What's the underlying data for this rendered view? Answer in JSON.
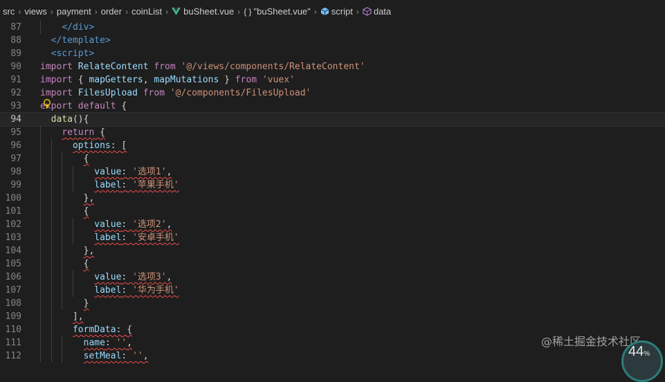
{
  "breadcrumb": {
    "items": [
      "src",
      "views",
      "payment",
      "order",
      "coinList",
      "buSheet.vue",
      "\"buSheet.vue\"",
      "script",
      "data"
    ],
    "icons": {
      "file": "vue-icon",
      "component": "braces-icon",
      "script": "cube-icon",
      "data": "cube-icon"
    }
  },
  "editor": {
    "current_line": "94",
    "lines": [
      {
        "n": "87",
        "text": "    </div>"
      },
      {
        "n": "88",
        "text": "  </template>"
      },
      {
        "n": "89",
        "text": "  <script>"
      },
      {
        "n": "90",
        "text": "import RelateContent from '@/views/components/RelateContent'"
      },
      {
        "n": "91",
        "text": "import { mapGetters, mapMutations } from 'vuex'"
      },
      {
        "n": "92",
        "text": "import FilesUpload from '@/components/FilesUpload'"
      },
      {
        "n": "93",
        "text": "export default {"
      },
      {
        "n": "94",
        "text": "  data(){"
      },
      {
        "n": "95",
        "text": "    return {"
      },
      {
        "n": "96",
        "text": "      options: ["
      },
      {
        "n": "97",
        "text": "        {"
      },
      {
        "n": "98",
        "text": "          value: '选项1',"
      },
      {
        "n": "99",
        "text": "          label: '苹果手机'"
      },
      {
        "n": "100",
        "text": "        },"
      },
      {
        "n": "101",
        "text": "        {"
      },
      {
        "n": "102",
        "text": "          value: '选项2',"
      },
      {
        "n": "103",
        "text": "          label: '安卓手机'"
      },
      {
        "n": "104",
        "text": "        },"
      },
      {
        "n": "105",
        "text": "        {"
      },
      {
        "n": "106",
        "text": "          value: '选项3',"
      },
      {
        "n": "107",
        "text": "          label: '华为手机'"
      },
      {
        "n": "108",
        "text": "        }"
      },
      {
        "n": "109",
        "text": "      ],"
      },
      {
        "n": "110",
        "text": "      formData: {"
      },
      {
        "n": "111",
        "text": "        name: '',"
      },
      {
        "n": "112",
        "text": "        setMeal: '',"
      }
    ]
  },
  "watermark": "@稀土掘金技术社区",
  "gauge": {
    "value": "44",
    "unit": "%"
  },
  "colors": {
    "background": "#1e1e1e",
    "keyword": "#c586c0",
    "string": "#ce9178",
    "property": "#9cdcfe",
    "error": "#f14c4c"
  }
}
